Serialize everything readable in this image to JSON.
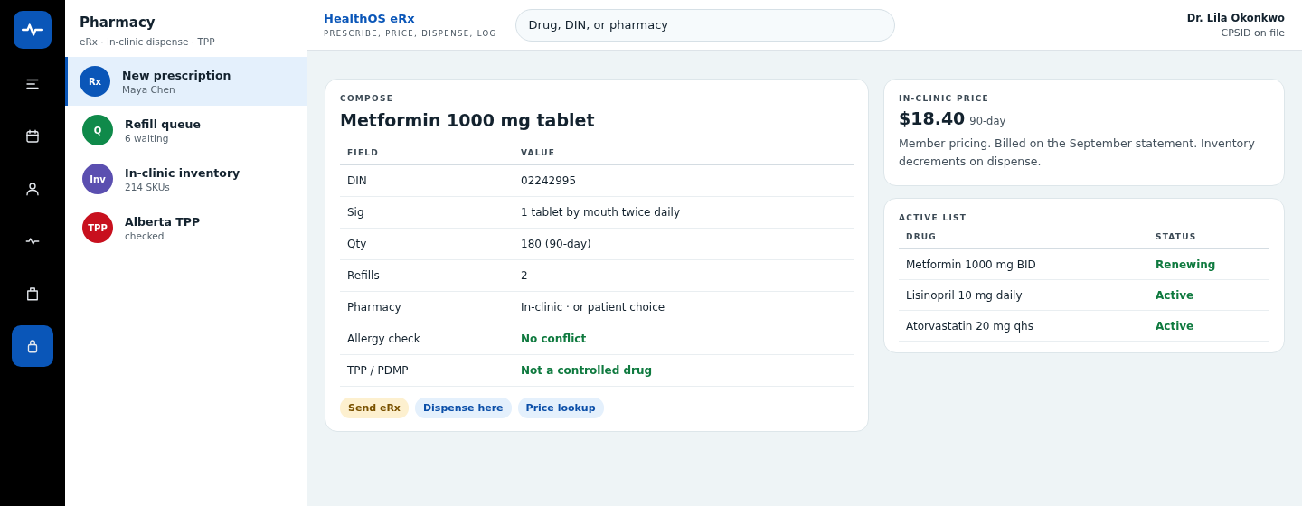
{
  "rail": {
    "items": [
      {
        "kind": "menu",
        "selected": false
      },
      {
        "kind": "calendar",
        "selected": false
      },
      {
        "kind": "person",
        "selected": false
      },
      {
        "kind": "pulse",
        "selected": false
      },
      {
        "kind": "bag",
        "selected": false
      },
      {
        "kind": "lock",
        "selected": true
      }
    ]
  },
  "sidebar": {
    "title": "Pharmacy",
    "subtitle": "eRx · in-clinic dispense · TPP",
    "items": [
      {
        "badge": "Rx",
        "color": "#0a56b8",
        "title": "New prescription",
        "subtitle": "Maya Chen",
        "selected": true
      },
      {
        "badge": "Q",
        "color": "#0f8a4a",
        "title": "Refill queue",
        "subtitle": "6 waiting",
        "selected": false
      },
      {
        "badge": "Inv",
        "color": "#5b4fb0",
        "title": "In-clinic inventory",
        "subtitle": "214 SKUs",
        "selected": false
      },
      {
        "badge": "TPP",
        "color": "#c8101e",
        "title": "Alberta TPP",
        "subtitle": "checked",
        "selected": false
      }
    ]
  },
  "header": {
    "brand": "HealthOS eRx",
    "tagline": "PRESCRIBE, PRICE, DISPENSE, LOG",
    "search": {
      "placeholder": "Drug, DIN, or pharmacy"
    },
    "user": "Dr. Lila Okonkwo",
    "user_note": "CPSID on file"
  },
  "compose": {
    "eyebrow": "COMPOSE",
    "title": "Metformin 1000 mg tablet",
    "columns": [
      "FIELD",
      "VALUE"
    ],
    "rows": [
      {
        "field": "DIN",
        "value": "02242995",
        "kind": "plain"
      },
      {
        "field": "Sig",
        "value": "1 tablet by mouth twice daily",
        "kind": "plain"
      },
      {
        "field": "Qty",
        "value": "180 (90-day)",
        "kind": "plain"
      },
      {
        "field": "Refills",
        "value": "2",
        "kind": "plain"
      },
      {
        "field": "Pharmacy",
        "value": "In-clinic · or patient choice",
        "kind": "plain"
      },
      {
        "field": "Allergy check",
        "value": "No conflict",
        "kind": "ok"
      },
      {
        "field": "TPP / PDMP",
        "value": "Not a controlled drug",
        "kind": "ok"
      }
    ],
    "actions": [
      {
        "label": "Send eRx",
        "kind": "warn"
      },
      {
        "label": "Dispense here",
        "kind": "info"
      },
      {
        "label": "Price lookup",
        "kind": "info"
      }
    ]
  },
  "price": {
    "eyebrow": "IN-CLINIC PRICE",
    "amount": "$18.40",
    "period": "90-day",
    "note": "Member pricing. Billed on the September statement. Inventory decrements on dispense."
  },
  "active_list": {
    "eyebrow": "ACTIVE LIST",
    "columns": [
      "DRUG",
      "STATUS"
    ],
    "rows": [
      {
        "drug": "Metformin 1000 mg BID",
        "status": "Renewing",
        "kind": "ok"
      },
      {
        "drug": "Lisinopril 10 mg daily",
        "status": "Active",
        "kind": "ok"
      },
      {
        "drug": "Atorvastatin 20 mg qhs",
        "status": "Active",
        "kind": "ok"
      }
    ]
  }
}
